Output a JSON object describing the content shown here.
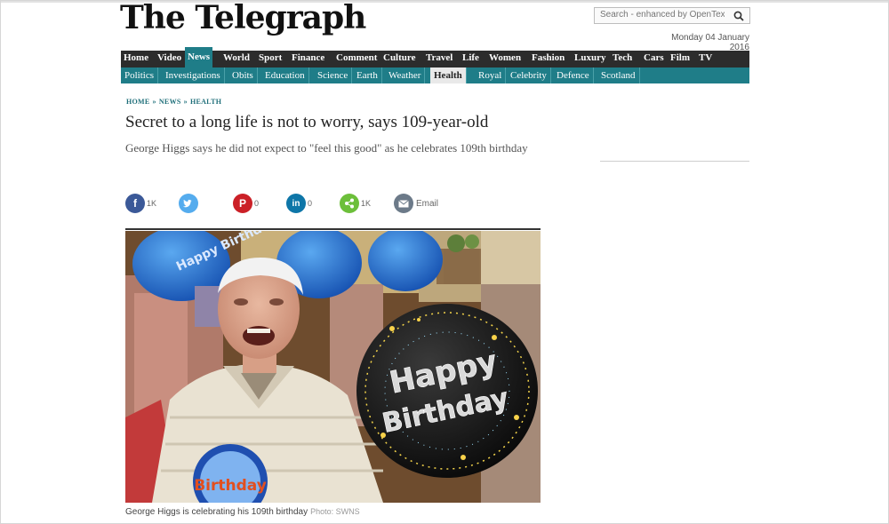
{
  "masthead": "The Telegraph",
  "search": {
    "placeholder": "Search - enhanced by OpenText"
  },
  "date": "Monday 04 January 2016",
  "nav_primary": [
    "Home",
    "Video",
    "News",
    "World",
    "Sport",
    "Finance",
    "Comment",
    "Culture",
    "Travel",
    "Life",
    "Women",
    "Fashion",
    "Luxury",
    "Tech",
    "Cars",
    "Film",
    "TV"
  ],
  "nav_primary_active": "News",
  "nav_secondary": [
    "Politics",
    "Investigations",
    "Obits",
    "Education",
    "Science",
    "Earth",
    "Weather",
    "Health",
    "Royal",
    "Celebrity",
    "Defence",
    "Scotland"
  ],
  "nav_secondary_active": "Health",
  "breadcrumb": [
    "HOME",
    "NEWS",
    "HEALTH"
  ],
  "headline": "Secret to a long life is not to worry, says 109-year-old",
  "standfirst": "George Higgs says he did not expect to \"feel this good\" as he celebrates 109th birthday",
  "share": {
    "facebook": {
      "icon": "facebook-icon",
      "count": "1K",
      "color": "#3b5998"
    },
    "twitter": {
      "icon": "twitter-icon",
      "count": "",
      "color": "#55acee"
    },
    "pinterest": {
      "icon": "pinterest-icon",
      "count": "0",
      "color": "#cb2027"
    },
    "linkedin": {
      "icon": "linkedin-icon",
      "count": "0",
      "color": "#0e76a8"
    },
    "share": {
      "icon": "share-icon",
      "count": "1K",
      "color": "#6cbf3a"
    },
    "email": {
      "icon": "email-icon",
      "label": "Email",
      "color": "#6c7a89"
    }
  },
  "photo": {
    "balloon_bday_text": "Happy Birthday",
    "balloon_small_text": "Happy Birthday",
    "badge_text": "Birthday"
  },
  "caption": {
    "text": "George Higgs is celebrating his 109th birthday",
    "credit": "Photo: SWNS"
  },
  "colors": {
    "nav_dark": "#2c2c2c",
    "nav_teal": "#1f7d88",
    "breadcrumb": "#1f6f7a"
  }
}
